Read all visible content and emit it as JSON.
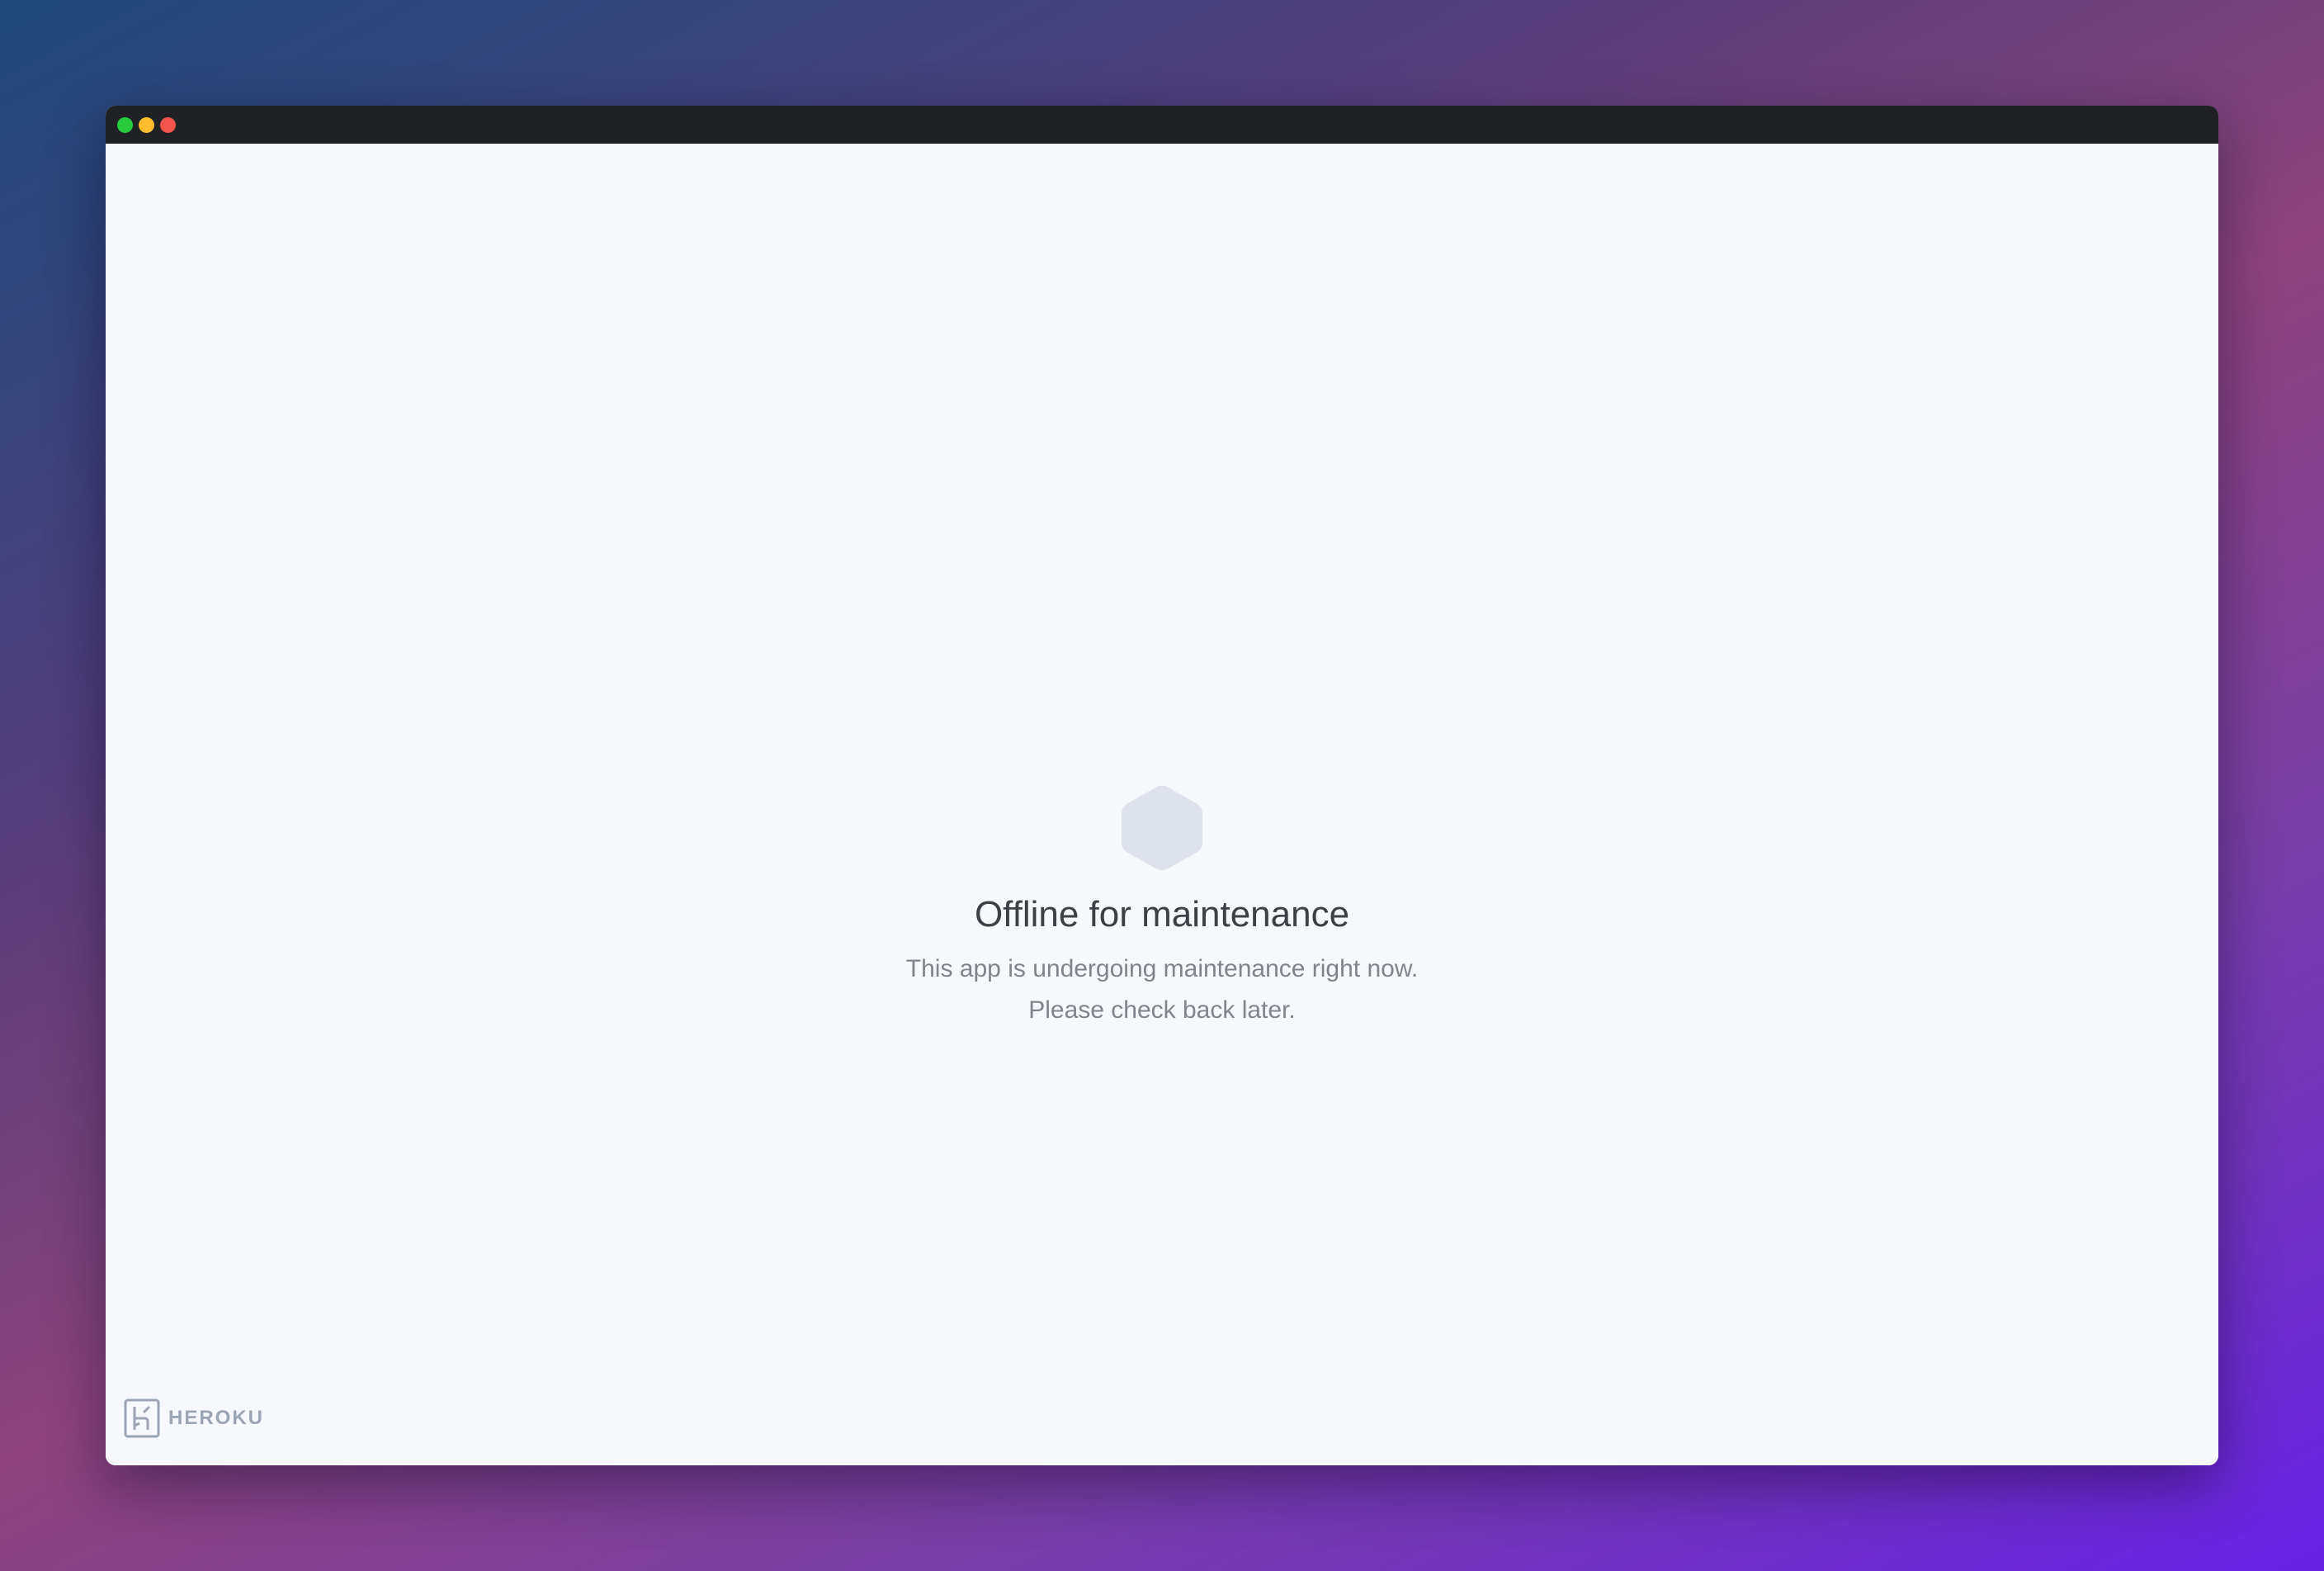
{
  "window": {
    "controls": [
      "close",
      "minimize",
      "maximize"
    ],
    "titlebar_color": "#202125"
  },
  "main": {
    "icon": "hexagon-icon",
    "title": "Offline for maintenance",
    "message_line1": "This app is undergoing maintenance right now.",
    "message_line2": "Please check back later."
  },
  "footer": {
    "brand_icon": "heroku-logo-icon",
    "brand_name": "HEROKU"
  },
  "colors": {
    "page_background": "#f6f8fb",
    "title_text": "#3d4046",
    "body_text": "#80848c",
    "brand_text": "#9ca5b4",
    "hexagon_fill": "#dde2ec",
    "dot_green": "#27c93f",
    "dot_yellow": "#febc2e",
    "dot_red": "#f2544e"
  }
}
